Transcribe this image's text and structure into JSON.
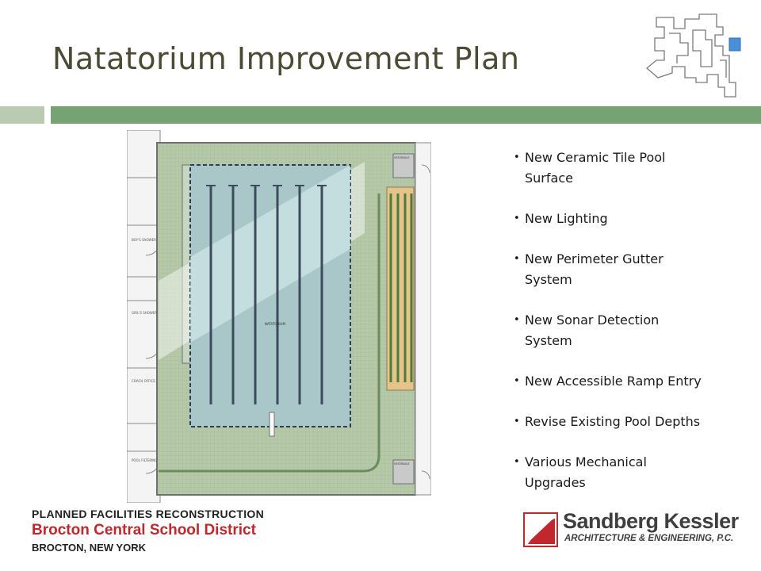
{
  "slide": {
    "title": "Natatorium Improvement Plan"
  },
  "bullets": [
    {
      "line1": "New Ceramic Tile Pool",
      "line2": "Surface"
    },
    {
      "line1": "New Lighting",
      "line2": ""
    },
    {
      "line1": "New Perimeter Gutter",
      "line2": "System"
    },
    {
      "line1": "New Sonar Detection",
      "line2": "System"
    },
    {
      "line1": "New Accessible Ramp Entry",
      "line2": ""
    },
    {
      "line1": "Revise Existing Pool Depths",
      "line2": ""
    },
    {
      "line1": "Various Mechanical",
      "line2": "Upgrades"
    }
  ],
  "plan_labels": {
    "room": "NATATORIUM",
    "boys": "BOY'S SHOWER",
    "girls": "GIRL'S SHOWER",
    "coach": "COACH OFFICE",
    "filter": "POOL FILTERING",
    "vestibule_top": "VESTIBULE",
    "vestibule_bottom": "VESTIBULE"
  },
  "footer": {
    "line1": "PLANNED FACILITIES RECONSTRUCTION",
    "line2": "Brocton Central School District",
    "line3": "BROCTON, NEW YORK"
  },
  "firm": {
    "name": "Sandberg Kessler",
    "subtitle": "ARCHITECTURE & ENGINEERING, P.C."
  },
  "colors": {
    "title": "#4b4a32",
    "accent_bar": "#76a374",
    "accent_bar_light": "#b9cbb1",
    "district_red": "#c1272d",
    "key_plan_highlight": "#4a90d9"
  },
  "icons": {
    "key_plan": "building-key-plan-icon",
    "firm_mark": "sandberg-kessler-mark-icon"
  }
}
